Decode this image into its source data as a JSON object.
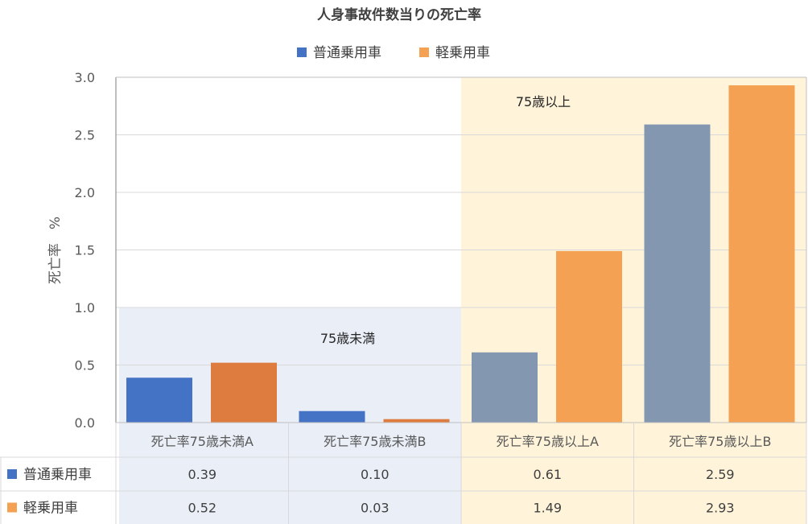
{
  "chart_data": {
    "type": "bar",
    "title": "人身事故件数当りの死亡率",
    "ylabel": "死亡率　%",
    "ylim": [
      0,
      3.0
    ],
    "yticks": [
      "0.0",
      "0.5",
      "1.0",
      "1.5",
      "2.0",
      "2.5",
      "3.0"
    ],
    "categories": [
      "死亡率75歳未満A",
      "死亡率75歳未満B",
      "死亡率75歳以上A",
      "死亡率75歳以上B"
    ],
    "series": [
      {
        "name": "普通乗用車",
        "values": [
          0.39,
          0.1,
          0.61,
          2.59
        ],
        "labels": [
          "0.39",
          "0.10",
          "0.61",
          "2.59"
        ]
      },
      {
        "name": "軽乗用車",
        "values": [
          0.52,
          0.03,
          1.49,
          2.93
        ],
        "labels": [
          "0.52",
          "0.03",
          "1.49",
          "2.93"
        ]
      }
    ],
    "regions": [
      {
        "label": "75歳未満",
        "color": "#E9EEF7"
      },
      {
        "label": "75歳以上",
        "color": "#FFF4DA"
      }
    ],
    "colors": {
      "series1_under": "#4472C4",
      "series1_over": "#8497B0",
      "series2_under": "#DE7C3F",
      "series2_over": "#F4A153"
    },
    "legend_position": "top",
    "grid": true
  }
}
